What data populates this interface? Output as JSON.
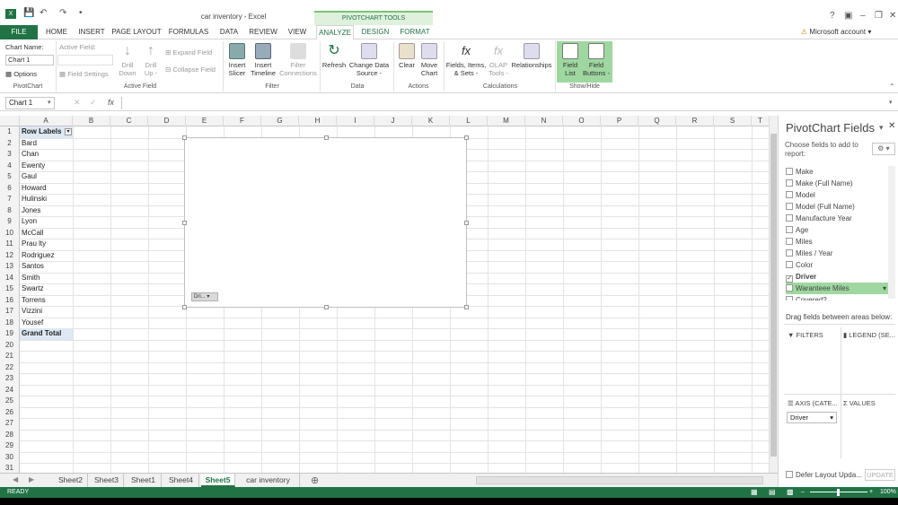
{
  "window": {
    "title": "car inventory - Excel",
    "contextual_group": "PIVOTCHART TOOLS",
    "account": "Microsoft account"
  },
  "tabs": [
    "FILE",
    "HOME",
    "INSERT",
    "PAGE LAYOUT",
    "FORMULAS",
    "DATA",
    "REVIEW",
    "VIEW",
    "ANALYZE",
    "DESIGN",
    "FORMAT"
  ],
  "ribbon": {
    "pivotchart": {
      "chart_name_label": "Chart Name:",
      "chart_name_value": "Chart 1",
      "options": "Options",
      "group": "PivotChart"
    },
    "active_field": {
      "label": "Active Field:",
      "field_settings": "Field Settings",
      "drill_down": "Drill Down",
      "drill_up": "Drill Up -",
      "expand": "Expand Field",
      "collapse": "Collapse Field",
      "group": "Active Field"
    },
    "filter": {
      "slicer": "Insert Slicer",
      "timeline": "Insert Timeline",
      "connections": "Filter Connections",
      "group": "Filter"
    },
    "data": {
      "refresh": "Refresh",
      "change_source": "Change Data Source -",
      "group": "Data"
    },
    "actions": {
      "clear": "Clear",
      "move": "Move Chart",
      "group": "Actions"
    },
    "calculations": {
      "fields": "Fields, Items, & Sets -",
      "olap": "OLAP Tools -",
      "relationships": "Relationships",
      "group": "Calculations"
    },
    "showhide": {
      "field_list": "Field List",
      "field_buttons": "Field Buttons -",
      "group": "Show/Hide"
    }
  },
  "formula_bar": {
    "name_box": "Chart 1",
    "fx": "fx"
  },
  "columns": [
    "A",
    "B",
    "C",
    "D",
    "E",
    "F",
    "G",
    "H",
    "I",
    "J",
    "K",
    "L",
    "M",
    "N",
    "O",
    "P",
    "Q",
    "R",
    "S",
    "T"
  ],
  "rows": [
    "Row Labels",
    "Bard",
    "Chan",
    "Ewenty",
    "Gaul",
    "Howard",
    "Hulinski",
    "Jones",
    "Lyon",
    "McCall",
    "Prau lty",
    "Rodriguez",
    "Santos",
    "Smith",
    "Swartz",
    "Torrens",
    "Vizzini",
    "Yousef",
    "Grand Total"
  ],
  "row_count": 31,
  "chart": {
    "field_button": "Dri..."
  },
  "sheets": [
    "Sheet2",
    "Sheet3",
    "Sheet1",
    "Sheet4",
    "Sheet5",
    "car inventory"
  ],
  "active_sheet": "Sheet5",
  "status": {
    "ready": "READY",
    "zoom": "100%"
  },
  "pane": {
    "title": "PivotChart Fields",
    "subtitle": "Choose fields to add to report:",
    "fields": [
      {
        "name": "Make",
        "checked": false
      },
      {
        "name": "Make (Full Name)",
        "checked": false
      },
      {
        "name": "Model",
        "checked": false
      },
      {
        "name": "Model (Full Name)",
        "checked": false
      },
      {
        "name": "Manufacture Year",
        "checked": false
      },
      {
        "name": "Age",
        "checked": false
      },
      {
        "name": "Miles",
        "checked": false
      },
      {
        "name": "Miles / Year",
        "checked": false
      },
      {
        "name": "Color",
        "checked": false
      },
      {
        "name": "Driver",
        "checked": true
      },
      {
        "name": "Waranteee Miles",
        "checked": false
      },
      {
        "name": "Covered?",
        "checked": false
      }
    ],
    "drag_hint": "Drag fields between areas below:",
    "areas": {
      "filters": "FILTERS",
      "legend": "LEGEND (SE...",
      "axis": "AXIS (CATE...",
      "values": "VALUES"
    },
    "axis_item": "Driver",
    "defer": "Defer Layout Upda...",
    "update": "UPDATE"
  },
  "colors": {
    "excel_green": "#217346",
    "highlight": "#9fd7a0"
  }
}
